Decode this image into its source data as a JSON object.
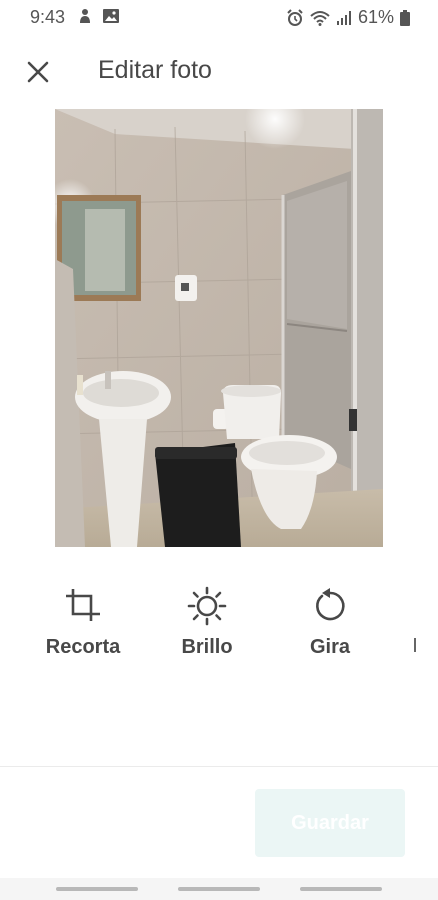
{
  "status_bar": {
    "time": "9:43",
    "battery": "61%"
  },
  "header": {
    "title": "Editar foto"
  },
  "photo": {
    "alt_subject": "bathroom"
  },
  "tools": [
    {
      "label": "Recorta",
      "icon": "crop-icon"
    },
    {
      "label": "Brillo",
      "icon": "brightness-icon"
    },
    {
      "label": "Gira",
      "icon": "rotate-icon"
    }
  ],
  "footer": {
    "save_label": "Guardar"
  },
  "colors": {
    "text": "#484848",
    "save_bg": "#ebf6f5",
    "save_text": "#ffffff"
  }
}
